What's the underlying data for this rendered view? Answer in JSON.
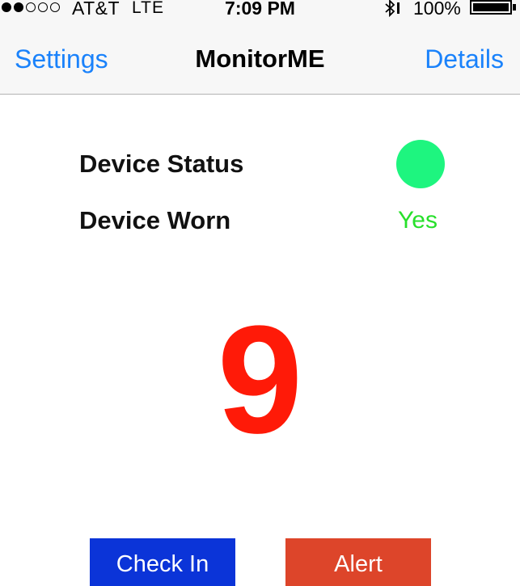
{
  "status_bar": {
    "signal_icon": "signal-strength-2-of-5-icon",
    "carrier": "AT&T",
    "network": "LTE",
    "time": "7:09 PM",
    "bluetooth_icon": "bluetooth-icon",
    "battery_percent": "100%",
    "battery_level": 1.0
  },
  "nav": {
    "left_label": "Settings",
    "title": "MonitorME",
    "right_label": "Details"
  },
  "device": {
    "status_label": "Device Status",
    "status_color": "#1ef57f",
    "worn_label": "Device Worn",
    "worn_value": "Yes",
    "worn_color": "#27e02b"
  },
  "counter": {
    "value": "9",
    "color": "#ff1a08"
  },
  "buttons": {
    "check_in_label": "Check In",
    "check_in_color": "#0b34d8",
    "alert_label": "Alert",
    "alert_color": "#dd452a"
  },
  "colors": {
    "accent": "#1a82fb",
    "navbar_bg": "#f7f7f7"
  }
}
